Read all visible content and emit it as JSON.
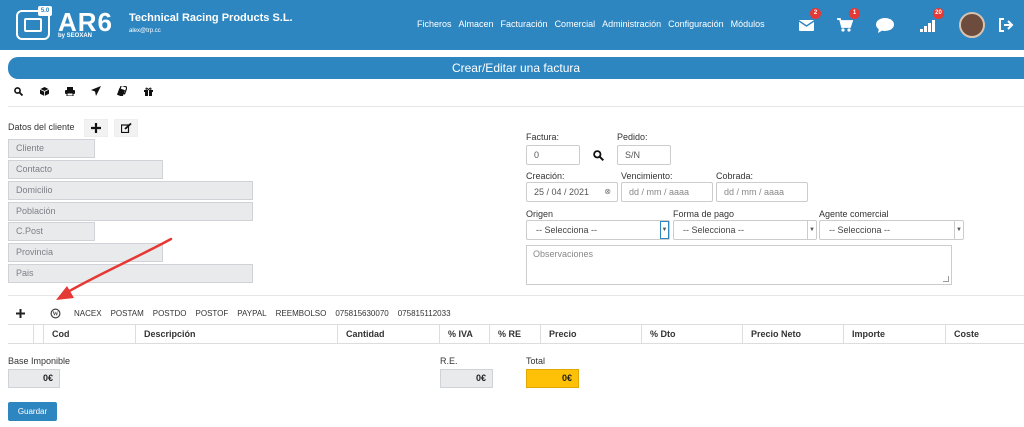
{
  "app": {
    "logo": "AR6",
    "logo_sub": "by SEOXAN",
    "logo_badge": "5.0",
    "company": "Technical Racing Products S.L.",
    "email": "alex@trp.cc"
  },
  "menu": [
    "Ficheros",
    "Almacen",
    "Facturación",
    "Comercial",
    "Administración",
    "Configuración",
    "Módulos"
  ],
  "top_icons": {
    "mail_count": "2",
    "cart_count": "1",
    "signal_count": "20"
  },
  "page_title": "Crear/Editar una factura",
  "client": {
    "section_label": "Datos del cliente",
    "fields": [
      "Cliente",
      "Contacto",
      "Domicilio",
      "Población",
      "C.Post",
      "Provincia",
      "Pais"
    ]
  },
  "invoice": {
    "factura_label": "Factura:",
    "factura_value": "0",
    "pedido_label": "Pedido:",
    "pedido_value": "S/N",
    "creacion_label": "Creación:",
    "creacion_value": "25 / 04 / 2021",
    "vencimiento_label": "Vencimiento:",
    "vencimiento_placeholder": "dd / mm / aaaa",
    "cobrada_label": "Cobrada:",
    "cobrada_placeholder": "dd / mm / aaaa",
    "origen_label": "Origen",
    "origen_value": "-- Selecciona --",
    "forma_pago_label": "Forma de pago",
    "forma_pago_value": "-- Selecciona --",
    "agente_label": "Agente comercial",
    "agente_value": "-- Selecciona --",
    "observaciones_placeholder": "Observaciones"
  },
  "shipping_links": [
    "NACEX",
    "POSTAM",
    "POSTDO",
    "POSTOF",
    "PAYPAL",
    "REEMBOLSO",
    "075815630070",
    "075815112033"
  ],
  "table_headers": [
    "Cod",
    "Descripción",
    "Cantidad",
    "% IVA",
    "% RE",
    "Precio",
    "% Dto",
    "Precio Neto",
    "Importe",
    "Coste"
  ],
  "totals": {
    "base_label": "Base Imponible",
    "base_value": "0€",
    "re_label": "R.E.",
    "re_value": "0€",
    "total_label": "Total",
    "total_value": "0€"
  },
  "save_label": "Guardar",
  "colors": {
    "primary": "#2e86c1",
    "total_highlight": "#ffc107",
    "badge": "#e53935",
    "annotation_arrow": "#e53935"
  }
}
